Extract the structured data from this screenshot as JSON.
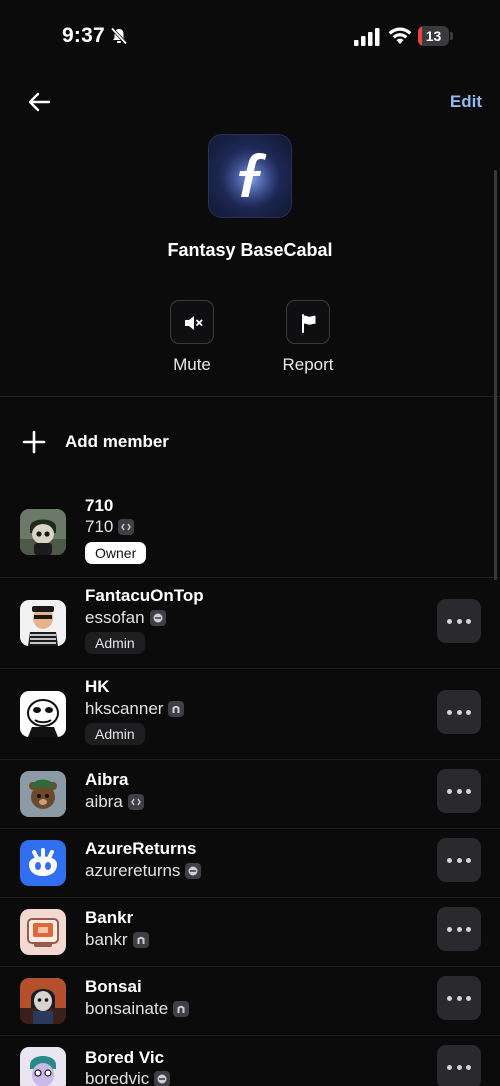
{
  "status_bar": {
    "time": "9:37",
    "battery_level": "13",
    "battery_fraction": 0.13
  },
  "header": {
    "back_icon": "arrow-left-icon",
    "edit_label": "Edit"
  },
  "group": {
    "avatar_icon": "italic-f-logo",
    "name": "Fantasy BaseCabal"
  },
  "actions": [
    {
      "label": "Mute",
      "icon": "speaker-muted-icon"
    },
    {
      "label": "Report",
      "icon": "flag-icon"
    }
  ],
  "add_member": {
    "label": "Add member",
    "icon": "plus-icon"
  },
  "members": [
    {
      "name": "710",
      "handle": "710",
      "badge": "code-icon",
      "role": "Owner",
      "has_menu": false
    },
    {
      "name": "FantacuOnTop",
      "handle": "essofan",
      "badge": "minus-circle-icon",
      "role": "Admin",
      "has_menu": true
    },
    {
      "name": "HK",
      "handle": "hkscanner",
      "badge": "arch-icon",
      "role": "Admin",
      "has_menu": true
    },
    {
      "name": "Aibra",
      "handle": "aibra",
      "badge": "code-icon",
      "role": "",
      "has_menu": true
    },
    {
      "name": "AzureReturns",
      "handle": "azurereturns",
      "badge": "minus-circle-icon",
      "role": "",
      "has_menu": true
    },
    {
      "name": "Bankr",
      "handle": "bankr",
      "badge": "arch-icon",
      "role": "",
      "has_menu": true
    },
    {
      "name": "Bonsai",
      "handle": "bonsainate",
      "badge": "arch-icon",
      "role": "",
      "has_menu": true
    },
    {
      "name": "Bored Vic",
      "handle": "boredvic",
      "badge": "minus-circle-icon",
      "role": "",
      "has_menu": true
    }
  ],
  "colors": {
    "background": "#0b0b0c",
    "accent_link": "#8fbbee",
    "battery_low": "#e5463f"
  }
}
